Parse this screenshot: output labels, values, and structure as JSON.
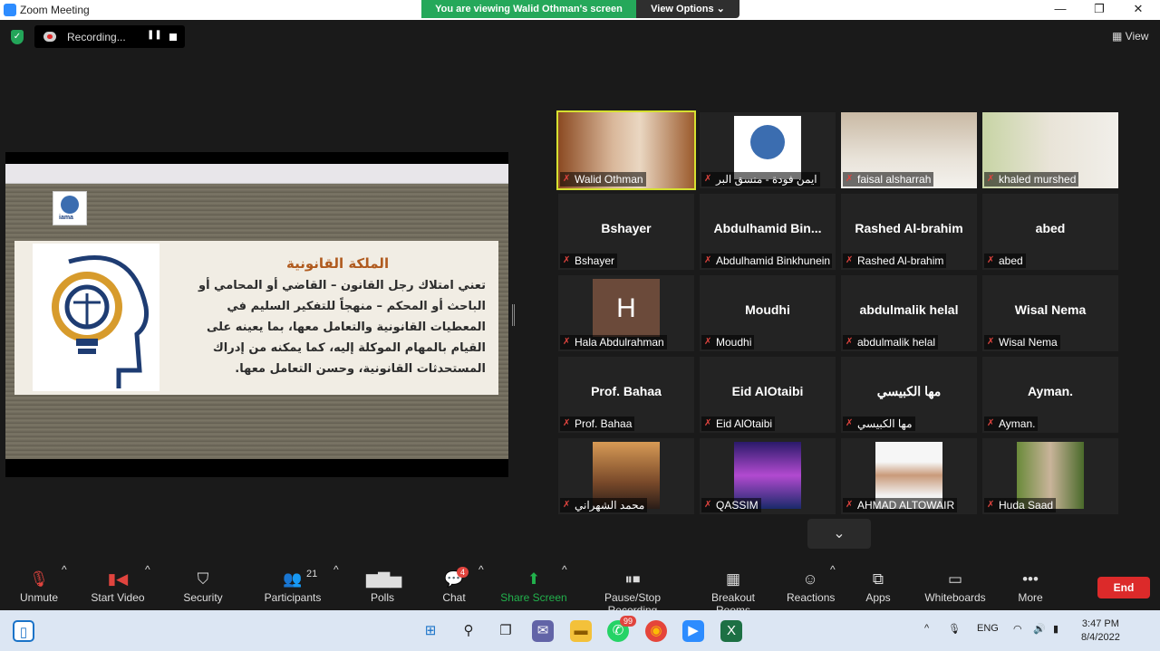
{
  "window": {
    "title": "Zoom Meeting",
    "minimize": "—",
    "maximize": "❐",
    "close": "✕"
  },
  "banner": {
    "viewing": "You are viewing Walid Othman's screen",
    "view_options": "View Options ⌄"
  },
  "recording": {
    "label": "Recording...",
    "pause": "❚❚",
    "stop": ""
  },
  "view_label": "View",
  "slide": {
    "logo_text": "iama",
    "heading": "الملكة القانونية",
    "body": "تعني امتلاك رجل القانون – القاضي أو المحامي أو الباحث أو المحكم – منهجاً للتفكير السليم في المعطيات القانونية والتعامل معها، بما يعينه على القيام بالمهام الموكلة إليه، كما يمكنه من إدراك المستحدثات القانونية، وحسن التعامل معها."
  },
  "participants": [
    {
      "name": "Walid Othman",
      "center": "",
      "type": "video-walid",
      "active": true
    },
    {
      "name": "ايمن فودة - منسق البر",
      "center": "",
      "type": "logo"
    },
    {
      "name": "faisal alsharrah",
      "center": "",
      "type": "video-faisal"
    },
    {
      "name": "khaled murshed",
      "center": "",
      "type": "video-khaled"
    },
    {
      "name": "Bshayer",
      "center": "Bshayer",
      "type": "name"
    },
    {
      "name": "Abdulhamid Binkhunein",
      "center": "Abdulhamid  Bin...",
      "type": "name"
    },
    {
      "name": "Rashed Al-brahim",
      "center": "Rashed Al-brahim",
      "type": "name"
    },
    {
      "name": "abed",
      "center": "abed",
      "type": "name"
    },
    {
      "name": "Hala Abdulrahman",
      "center": "H",
      "type": "avatar"
    },
    {
      "name": "Moudhi",
      "center": "Moudhi",
      "type": "name"
    },
    {
      "name": "abdulmalik helal",
      "center": "abdulmalik helal",
      "type": "name"
    },
    {
      "name": "Wisal Nema",
      "center": "Wisal Nema",
      "type": "name"
    },
    {
      "name": "Prof. Bahaa",
      "center": "Prof. Bahaa",
      "type": "name"
    },
    {
      "name": "Eid AlOtaibi",
      "center": "Eid AlOtaibi",
      "type": "name"
    },
    {
      "name": "مها الكبيسي",
      "center": "مها الكبيسي",
      "type": "name"
    },
    {
      "name": "Ayman.",
      "center": "Ayman.",
      "type": "name"
    },
    {
      "name": "محمد الشهراني",
      "center": "",
      "type": "photo-sunset"
    },
    {
      "name": "QASSIM",
      "center": "",
      "type": "photo-city"
    },
    {
      "name": "AHMAD ALTOWAIR",
      "center": "",
      "type": "photo-ahmad"
    },
    {
      "name": "Huda Saad",
      "center": "",
      "type": "photo-huda"
    }
  ],
  "toolbar": {
    "unmute": "Unmute",
    "start_video": "Start Video",
    "security": "Security",
    "participants": "Participants",
    "participants_count": "21",
    "polls": "Polls",
    "chat": "Chat",
    "chat_badge": "4",
    "share_screen": "Share Screen",
    "pause_stop_recording": "Pause/Stop Recording",
    "breakout_rooms": "Breakout Rooms",
    "reactions": "Reactions",
    "apps": "Apps",
    "whiteboards": "Whiteboards",
    "more": "More",
    "end": "End"
  },
  "taskbar": {
    "whatsapp_badge": "99",
    "language": "ENG",
    "time": "3:47 PM",
    "date": "8/4/2022"
  },
  "colors": {
    "accent_green": "#25a85a",
    "end_red": "#dc2a2a",
    "active_border": "#d6e030"
  }
}
